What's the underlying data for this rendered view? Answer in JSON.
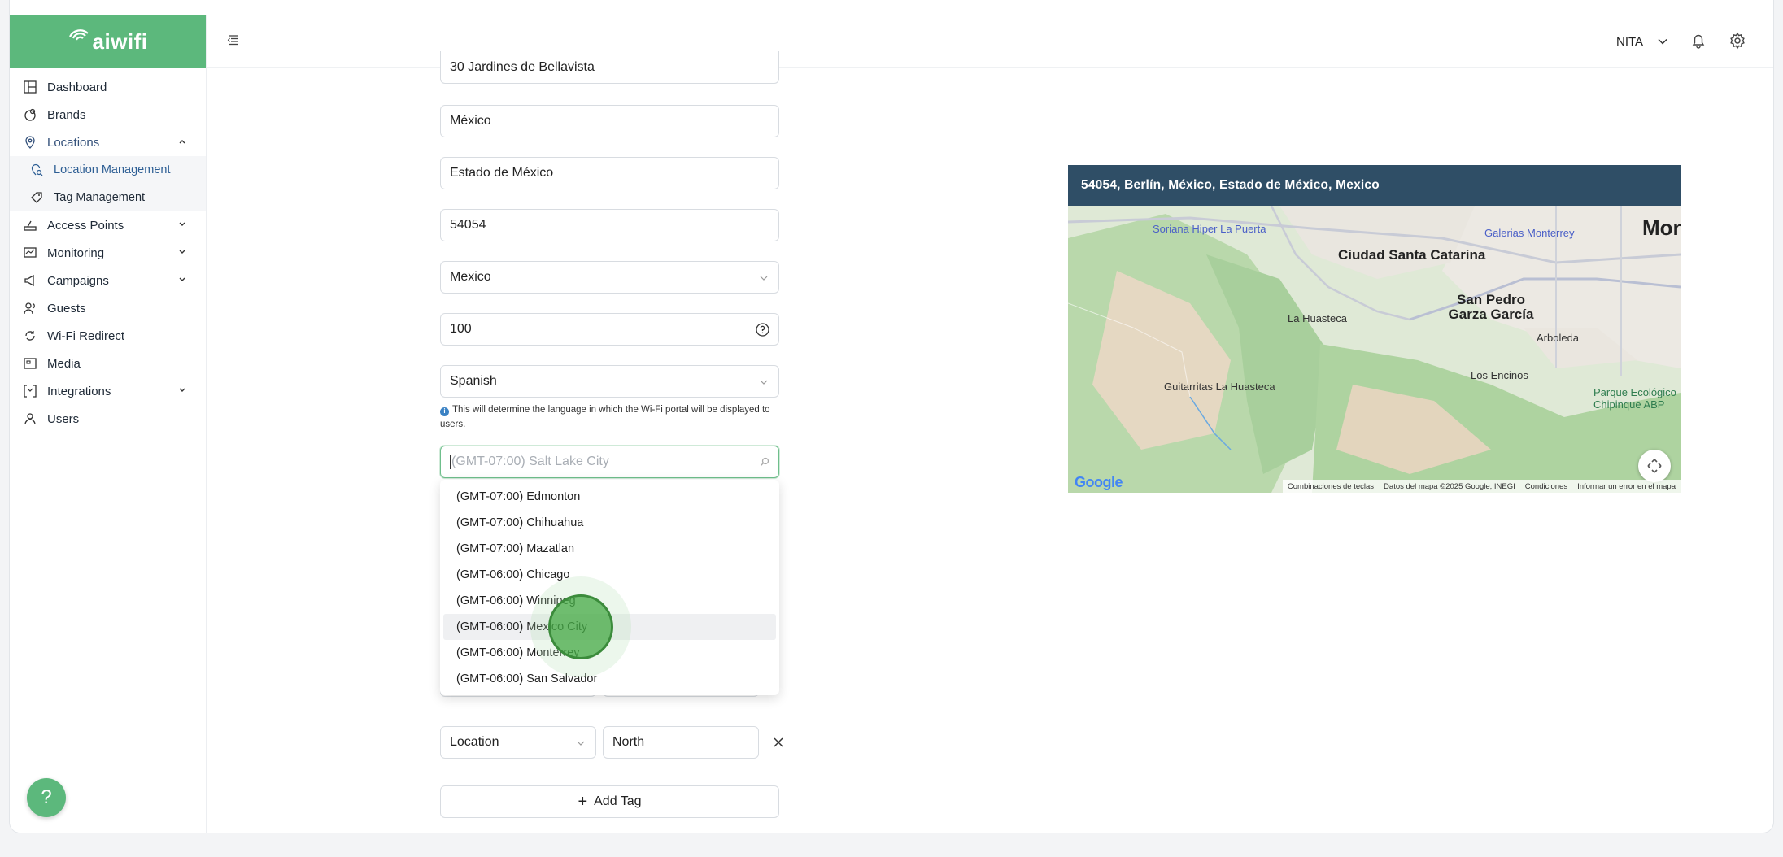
{
  "brand": {
    "name": "aiwifi",
    "color": "#5cb87c"
  },
  "sidebar": {
    "items": [
      {
        "label": "Dashboard",
        "icon": "dashboard-icon"
      },
      {
        "label": "Brands",
        "icon": "brands-icon"
      },
      {
        "label": "Locations",
        "icon": "location-pin-icon",
        "expanded": true
      },
      {
        "label": "Access Points",
        "icon": "access-point-icon"
      },
      {
        "label": "Monitoring",
        "icon": "monitoring-icon"
      },
      {
        "label": "Campaigns",
        "icon": "megaphone-icon"
      },
      {
        "label": "Guests",
        "icon": "users-icon"
      },
      {
        "label": "Wi-Fi Redirect",
        "icon": "redirect-icon"
      },
      {
        "label": "Media",
        "icon": "media-icon"
      },
      {
        "label": "Integrations",
        "icon": "integrations-icon"
      },
      {
        "label": "Users",
        "icon": "user-icon"
      }
    ],
    "locations_sub": [
      {
        "label": "Location Management",
        "icon": "location-search-icon"
      },
      {
        "label": "Tag Management",
        "icon": "tag-icon"
      }
    ],
    "help_label": "?"
  },
  "header": {
    "user_name": "NITA"
  },
  "form": {
    "street": "30 Jardines de Bellavista",
    "city": "México",
    "state": "Estado de México",
    "zip": "54054",
    "country": "Mexico",
    "radius": "100",
    "language": "Spanish",
    "language_hint": "This will determine the language in which the Wi-Fi portal will be displayed to users.",
    "timezone_placeholder": "(GMT-07:00) Salt Lake City"
  },
  "timezone_options": [
    "(GMT-07:00) Edmonton",
    "(GMT-07:00) Chihuahua",
    "(GMT-07:00) Mazatlan",
    "(GMT-06:00) Chicago",
    "(GMT-06:00) Winnipeg",
    "(GMT-06:00) Mexico City",
    "(GMT-06:00) Monterrey",
    "(GMT-06:00) San Salvador"
  ],
  "timezone_highlighted": "(GMT-06:00) Mexico City",
  "tags": {
    "key": "Location",
    "value": "North",
    "add_label": "Add Tag"
  },
  "map": {
    "title": "54054, Berlín, México, Estado de México, Mexico",
    "labels": {
      "ciudad_santa_catarina": "Ciudad Santa Catarina",
      "san_pedro": "San Pedro Garza García",
      "soriana": "Soriana Hiper La Puerta",
      "galerias": "Galerias Monterrey",
      "la_huasteca": "La Huasteca",
      "arboleda": "Arboleda",
      "los_encinos": "Los Encinos",
      "guitarritas": "Guitarritas La Huasteca",
      "parque": "Parque Ecológico Chipinque ABP",
      "mont": "Mont",
      "google": "Google"
    },
    "attribution": [
      "Combinaciones de teclas",
      "Datos del mapa ©2025 Google, INEGI",
      "Condiciones",
      "Informar un error en el mapa"
    ]
  }
}
